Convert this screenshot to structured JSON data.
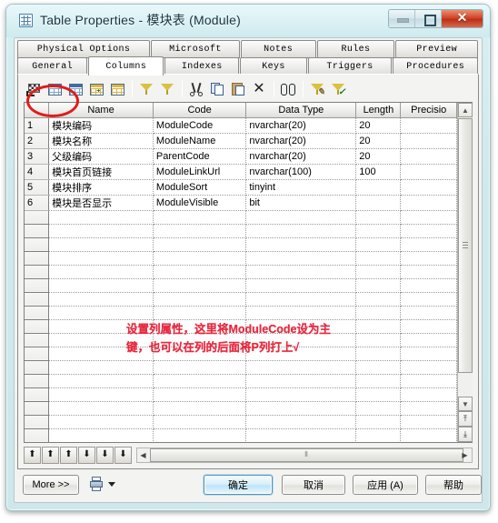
{
  "window": {
    "title": "Table Properties - 模块表 (Module)",
    "icon": "table-icon",
    "buttons": {
      "minimize": "minimize-icon",
      "maximize": "maximize-icon",
      "close": "✕"
    }
  },
  "tabs": {
    "row1": [
      {
        "label": "Physical Options",
        "active": false
      },
      {
        "label": "Microsoft",
        "active": false
      },
      {
        "label": "Notes",
        "active": false
      },
      {
        "label": "Rules",
        "active": false
      },
      {
        "label": "Preview",
        "active": false
      }
    ],
    "row2": [
      {
        "label": "General",
        "active": false
      },
      {
        "label": "Columns",
        "active": true
      },
      {
        "label": "Indexes",
        "active": false
      },
      {
        "label": "Keys",
        "active": false
      },
      {
        "label": "Triggers",
        "active": false
      },
      {
        "label": "Procedures",
        "active": false
      }
    ]
  },
  "toolbar": {
    "items": [
      {
        "name": "properties-icon"
      },
      {
        "name": "insert-row-icon"
      },
      {
        "name": "insert-row-after-icon"
      },
      {
        "name": "add-column-icon"
      },
      {
        "name": "replace-column-icon"
      },
      {
        "name": "add-object-icon"
      },
      {
        "name": "reuse-object-icon"
      },
      {
        "name": "cut-icon"
      },
      {
        "name": "copy-icon"
      },
      {
        "name": "paste-icon"
      },
      {
        "name": "delete-icon"
      },
      {
        "name": "find-icon"
      },
      {
        "name": "filter-icon"
      },
      {
        "name": "apply-filter-icon"
      }
    ]
  },
  "grid": {
    "headers": [
      "",
      "Name",
      "Code",
      "Data Type",
      "Length",
      "Precisio"
    ],
    "rows": [
      {
        "num": "1",
        "name": "模块编码",
        "code": "ModuleCode",
        "type": "nvarchar(20)",
        "length": "20",
        "precision": ""
      },
      {
        "num": "2",
        "name": "模块名称",
        "code": "ModuleName",
        "type": "nvarchar(20)",
        "length": "20",
        "precision": ""
      },
      {
        "num": "3",
        "name": "父级编码",
        "code": "ParentCode",
        "type": "nvarchar(20)",
        "length": "20",
        "precision": ""
      },
      {
        "num": "4",
        "name": "模块首页链接",
        "code": "ModuleLinkUrl",
        "type": "nvarchar(100)",
        "length": "100",
        "precision": ""
      },
      {
        "num": "5",
        "name": "模块排序",
        "code": "ModuleSort",
        "type": "tinyint",
        "length": "",
        "precision": ""
      },
      {
        "num": "6",
        "name": "模块是否显示",
        "code": "ModuleVisible",
        "type": "bit",
        "length": "",
        "precision": ""
      }
    ],
    "empty_row_count": 22,
    "annotation": {
      "line1": "设置列属性，这里将ModuleCode设为主",
      "line2": "键，也可以在列的后面将P列打上√",
      "color": "#e8293f"
    }
  },
  "grid_nav": {
    "buttons": [
      "insert-row-top-icon",
      "move-up-all-icon",
      "move-up-icon",
      "move-down-icon",
      "move-down-all-icon",
      "move-bottom-icon"
    ],
    "hscroll_grip": "⦀"
  },
  "vscroll": {
    "up": "▲",
    "down": "▼",
    "extra_top": "⤒",
    "extra_bottom": "⤓"
  },
  "footer": {
    "more": "More >>",
    "print": "print-icon",
    "print_caret": "dropdown-caret-icon",
    "ok": "确定",
    "cancel": "取消",
    "apply": "应用 (A)",
    "help": "帮助"
  }
}
